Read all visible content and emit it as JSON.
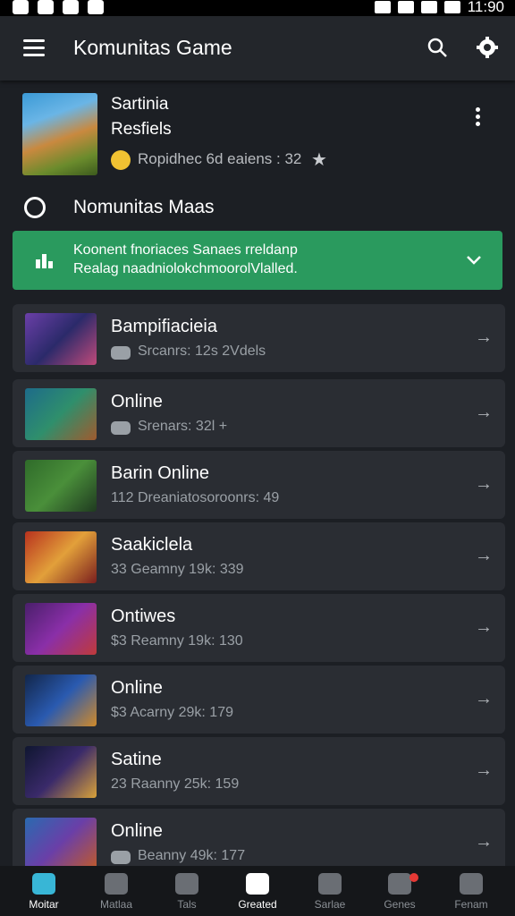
{
  "status_bar": {
    "time": "11:90"
  },
  "header": {
    "title": "Komunitas Game"
  },
  "featured": {
    "title": "Sartinia",
    "subtitle": "Resfiels",
    "meta": "Ropidhec 6d eaiens : 32"
  },
  "section": {
    "title": "Nomunitas Maas"
  },
  "banner": {
    "line1": "Koonent fnoriaces Sanaes rreldanp",
    "line2": "Realag naadniolokchmoorolVlalled."
  },
  "list": [
    {
      "title": "Bampifiacieia",
      "meta": "Srcanrs: 12s 2Vdels"
    },
    {
      "title": "Online",
      "meta": "Srenars: 32l +"
    },
    {
      "title": "Barin Online",
      "meta": "112 Dreaniatosoroonrs: 49"
    },
    {
      "title": "Saakiclela",
      "meta": "33 Geamny 19k: 339"
    },
    {
      "title": "Ontiwes",
      "meta": "$3 Reamny 19k: 130"
    },
    {
      "title": "Online",
      "meta": "$3 Acarny 29k: 179"
    },
    {
      "title": "Satine",
      "meta": "23 Raanny 25k: 159"
    },
    {
      "title": "Online",
      "meta": "Beanny 49k: 177"
    }
  ],
  "bottom_nav": [
    {
      "label": "Moitar",
      "icon": "home-icon"
    },
    {
      "label": "Matlaa",
      "icon": "search-icon"
    },
    {
      "label": "Tals",
      "icon": "tablet-icon"
    },
    {
      "label": "Greated",
      "icon": "chat-icon"
    },
    {
      "label": "Sarlae",
      "icon": "person-icon"
    },
    {
      "label": "Genes",
      "icon": "globe-icon"
    },
    {
      "label": "Fenam",
      "icon": "profile-icon"
    }
  ],
  "colors": {
    "accent": "#2a9a5e",
    "nav_active": "#38b6d6"
  }
}
